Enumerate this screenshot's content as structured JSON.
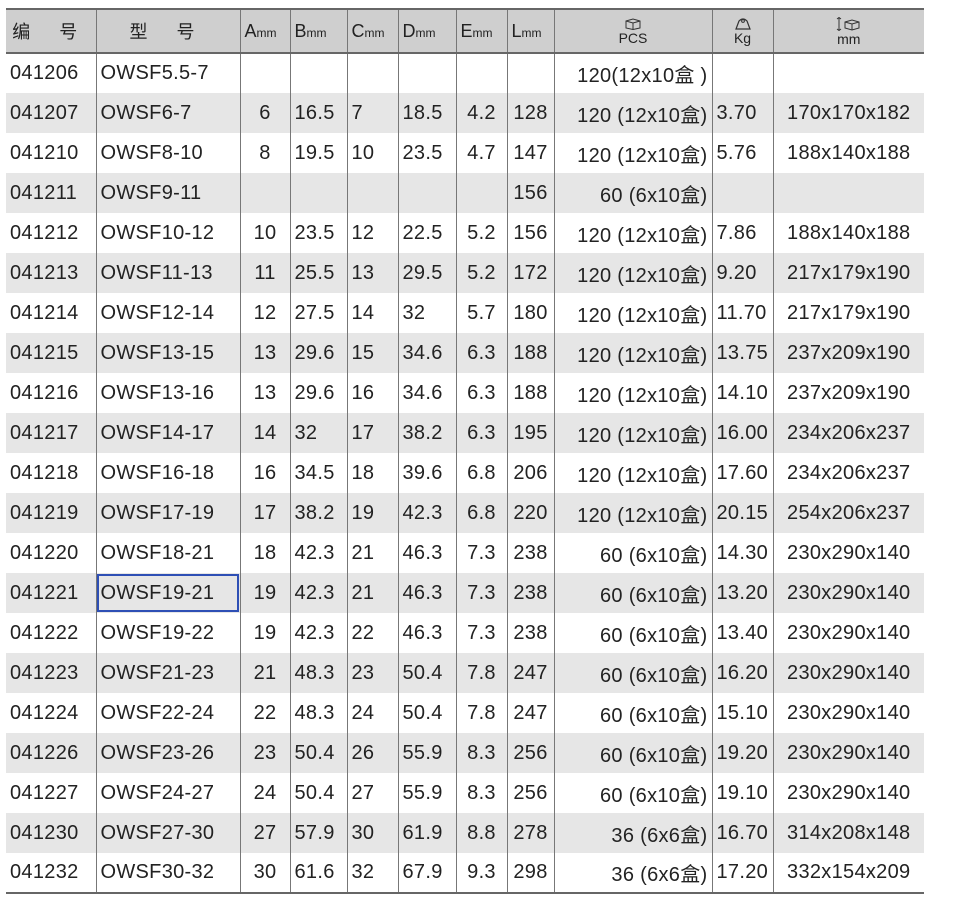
{
  "table": {
    "header": {
      "code": "编 号",
      "model": "型 号",
      "dim_a": "A",
      "dim_b": "B",
      "dim_c": "C",
      "dim_d": "D",
      "dim_e": "E",
      "dim_l": "L",
      "dim_unit": "mm",
      "pcs_icon": "box-icon",
      "pcs": "PCS",
      "weight_icon": "weight-icon",
      "weight": "Kg",
      "size_icon": "carton-dimension-icon",
      "size": "mm"
    },
    "selected_row": 13,
    "rows": [
      {
        "code": "041206",
        "model": "OWSF5.5-7",
        "a": "",
        "b": "",
        "c": "",
        "d": "",
        "e": "",
        "l": "",
        "pcs": "120(12x10盒 )",
        "kg": "",
        "size": ""
      },
      {
        "code": "041207",
        "model": "OWSF6-7",
        "a": "6",
        "b": "16.5",
        "c": "7",
        "d": "18.5",
        "e": "4.2",
        "l": "128",
        "pcs": "120 (12x10盒)",
        "kg": "3.70",
        "size": "170x170x182"
      },
      {
        "code": "041210",
        "model": "OWSF8-10",
        "a": "8",
        "b": "19.5",
        "c": "10",
        "d": "23.5",
        "e": "4.7",
        "l": "147",
        "pcs": "120 (12x10盒)",
        "kg": "5.76",
        "size": "188x140x188"
      },
      {
        "code": "041211",
        "model": "OWSF9-11",
        "a": "",
        "b": "",
        "c": "",
        "d": "",
        "e": "",
        "l": "156",
        "pcs": "60 (6x10盒)",
        "kg": "",
        "size": ""
      },
      {
        "code": "041212",
        "model": "OWSF10-12",
        "a": "10",
        "b": "23.5",
        "c": "12",
        "d": "22.5",
        "e": "5.2",
        "l": "156",
        "pcs": "120 (12x10盒)",
        "kg": "7.86",
        "size": "188x140x188"
      },
      {
        "code": "041213",
        "model": "OWSF11-13",
        "a": "11",
        "b": "25.5",
        "c": "13",
        "d": "29.5",
        "e": "5.2",
        "l": "172",
        "pcs": "120 (12x10盒)",
        "kg": "9.20",
        "size": "217x179x190"
      },
      {
        "code": "041214",
        "model": "OWSF12-14",
        "a": "12",
        "b": "27.5",
        "c": "14",
        "d": "32",
        "e": "5.7",
        "l": "180",
        "pcs": "120 (12x10盒)",
        "kg": "11.70",
        "size": "217x179x190"
      },
      {
        "code": "041215",
        "model": "OWSF13-15",
        "a": "13",
        "b": "29.6",
        "c": "15",
        "d": "34.6",
        "e": "6.3",
        "l": "188",
        "pcs": "120 (12x10盒)",
        "kg": "13.75",
        "size": "237x209x190"
      },
      {
        "code": "041216",
        "model": "OWSF13-16",
        "a": "13",
        "b": "29.6",
        "c": "16",
        "d": "34.6",
        "e": "6.3",
        "l": "188",
        "pcs": "120 (12x10盒)",
        "kg": "14.10",
        "size": "237x209x190"
      },
      {
        "code": "041217",
        "model": "OWSF14-17",
        "a": "14",
        "b": "32",
        "c": "17",
        "d": "38.2",
        "e": "6.3",
        "l": "195",
        "pcs": "120 (12x10盒)",
        "kg": "16.00",
        "size": "234x206x237"
      },
      {
        "code": "041218",
        "model": "OWSF16-18",
        "a": "16",
        "b": "34.5",
        "c": "18",
        "d": "39.6",
        "e": "6.8",
        "l": "206",
        "pcs": "120 (12x10盒)",
        "kg": "17.60",
        "size": "234x206x237"
      },
      {
        "code": "041219",
        "model": "OWSF17-19",
        "a": "17",
        "b": "38.2",
        "c": "19",
        "d": "42.3",
        "e": "6.8",
        "l": "220",
        "pcs": "120 (12x10盒)",
        "kg": "20.15",
        "size": "254x206x237"
      },
      {
        "code": "041220",
        "model": "OWSF18-21",
        "a": "18",
        "b": "42.3",
        "c": "21",
        "d": "46.3",
        "e": "7.3",
        "l": "238",
        "pcs": "60 (6x10盒)",
        "kg": "14.30",
        "size": "230x290x140"
      },
      {
        "code": "041221",
        "model": "OWSF19-21",
        "a": "19",
        "b": "42.3",
        "c": "21",
        "d": "46.3",
        "e": "7.3",
        "l": "238",
        "pcs": "60 (6x10盒)",
        "kg": "13.20",
        "size": "230x290x140"
      },
      {
        "code": "041222",
        "model": "OWSF19-22",
        "a": "19",
        "b": "42.3",
        "c": "22",
        "d": "46.3",
        "e": "7.3",
        "l": "238",
        "pcs": "60 (6x10盒)",
        "kg": "13.40",
        "size": "230x290x140"
      },
      {
        "code": "041223",
        "model": "OWSF21-23",
        "a": "21",
        "b": "48.3",
        "c": "23",
        "d": "50.4",
        "e": "7.8",
        "l": "247",
        "pcs": "60 (6x10盒)",
        "kg": "16.20",
        "size": "230x290x140"
      },
      {
        "code": "041224",
        "model": "OWSF22-24",
        "a": "22",
        "b": "48.3",
        "c": "24",
        "d": "50.4",
        "e": "7.8",
        "l": "247",
        "pcs": "60 (6x10盒)",
        "kg": "15.10",
        "size": "230x290x140"
      },
      {
        "code": "041226",
        "model": "OWSF23-26",
        "a": "23",
        "b": "50.4",
        "c": "26",
        "d": "55.9",
        "e": "8.3",
        "l": "256",
        "pcs": "60 (6x10盒)",
        "kg": "19.20",
        "size": "230x290x140"
      },
      {
        "code": "041227",
        "model": "OWSF24-27",
        "a": "24",
        "b": "50.4",
        "c": "27",
        "d": "55.9",
        "e": "8.3",
        "l": "256",
        "pcs": "60 (6x10盒)",
        "kg": "19.10",
        "size": "230x290x140"
      },
      {
        "code": "041230",
        "model": "OWSF27-30",
        "a": "27",
        "b": "57.9",
        "c": "30",
        "d": "61.9",
        "e": "8.8",
        "l": "278",
        "pcs": "36 (6x6盒)",
        "kg": "16.70",
        "size": "314x208x148"
      },
      {
        "code": "041232",
        "model": "OWSF30-32",
        "a": "30",
        "b": "61.6",
        "c": "32",
        "d": "67.9",
        "e": "9.3",
        "l": "298",
        "pcs": "36 (6x6盒)",
        "kg": "17.20",
        "size": "332x154x209"
      }
    ]
  }
}
